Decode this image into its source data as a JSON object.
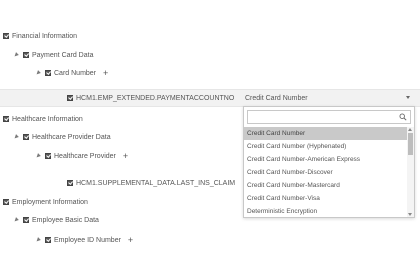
{
  "tree": {
    "financial": "Financial Information",
    "payment_card": "Payment Card Data",
    "card_number": "Card Number",
    "hcm1_paymentaccount": "HCM1.EMP_EXTENDED.PAYMENTACCOUNTNO",
    "healthcare": "Healthcare Information",
    "healthcare_provider_data": "Healthcare Provider Data",
    "healthcare_provider": "Healthcare Provider",
    "hcm1_insclaim": "HCM1.SUPPLEMENTAL_DATA.LAST_INS_CLAIM",
    "employment": "Employment Information",
    "employee_basic": "Employee Basic Data",
    "employee_id": "Employee ID Number",
    "plus": "+"
  },
  "field": {
    "selected_value": "Credit Card Number"
  },
  "dropdown": {
    "search_value": "",
    "options": [
      "Credit Card Number",
      "Credit Card Number (Hyphenated)",
      "Credit Card Number-American Express",
      "Credit Card Number-Discover",
      "Credit Card Number-Mastercard",
      "Credit Card Number-Visa",
      "Deterministic Encryption"
    ],
    "active_index": 0
  },
  "colors": {
    "checkbox": "#595959",
    "selected_row_bg": "#f2f2f2",
    "active_option_bg": "#c9c9c9"
  }
}
